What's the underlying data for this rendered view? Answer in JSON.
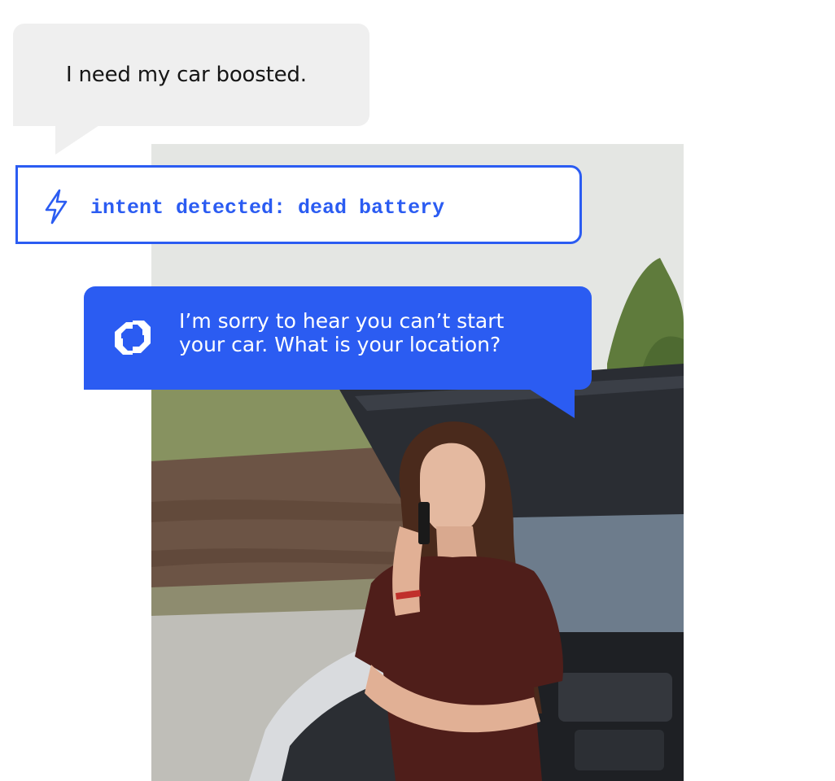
{
  "user_message": {
    "text": "I need my car boosted."
  },
  "intent": {
    "icon": "lightning-bolt-icon",
    "text": "intent detected: dead battery"
  },
  "agent_message": {
    "icon": "brand-logo-icon",
    "line_1": "I’m sorry to hear you can’t start",
    "line_2": "your car. What is your location?"
  },
  "photo": {
    "subject": "woman-on-phone-by-car-with-open-hood"
  },
  "colors": {
    "accent": "#2b5cf2",
    "user_bubble": "#efefef",
    "user_text": "#161616",
    "agent_text": "#ffffff"
  }
}
